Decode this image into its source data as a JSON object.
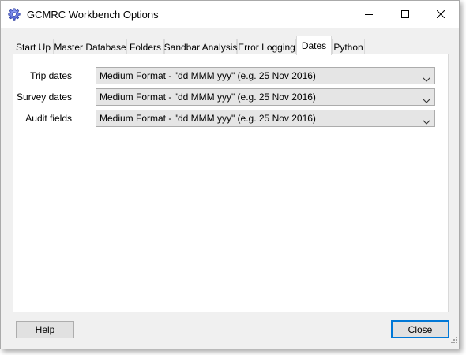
{
  "window": {
    "title": "GCMRC Workbench Options"
  },
  "tabs": [
    {
      "label": "Start Up",
      "active": false
    },
    {
      "label": "Master Database",
      "active": false
    },
    {
      "label": "Folders",
      "active": false
    },
    {
      "label": "Sandbar Analysis",
      "active": false
    },
    {
      "label": "Error Logging",
      "active": false
    },
    {
      "label": "Dates",
      "active": true
    },
    {
      "label": "Python",
      "active": false
    }
  ],
  "dates": {
    "trip_dates": {
      "label": "Trip dates",
      "value": "Medium Format - \"dd MMM yyy\" (e.g. 25 Nov 2016)"
    },
    "survey_dates": {
      "label": "Survey dates",
      "value": "Medium Format - \"dd MMM yyy\" (e.g. 25 Nov 2016)"
    },
    "audit_fields": {
      "label": "Audit fields",
      "value": "Medium Format - \"dd MMM yyy\" (e.g. 25 Nov 2016)"
    }
  },
  "buttons": {
    "help": "Help",
    "close": "Close"
  },
  "icons": {
    "app": "gear-icon",
    "minimize": "minimize-icon",
    "maximize": "maximize-icon",
    "close": "close-icon",
    "dropdown": "chevron-down-icon",
    "resize": "resize-grip-icon"
  },
  "colors": {
    "accent": "#0078d7",
    "window_bg": "#f0f0f0",
    "combo_bg": "#e5e5e5"
  }
}
